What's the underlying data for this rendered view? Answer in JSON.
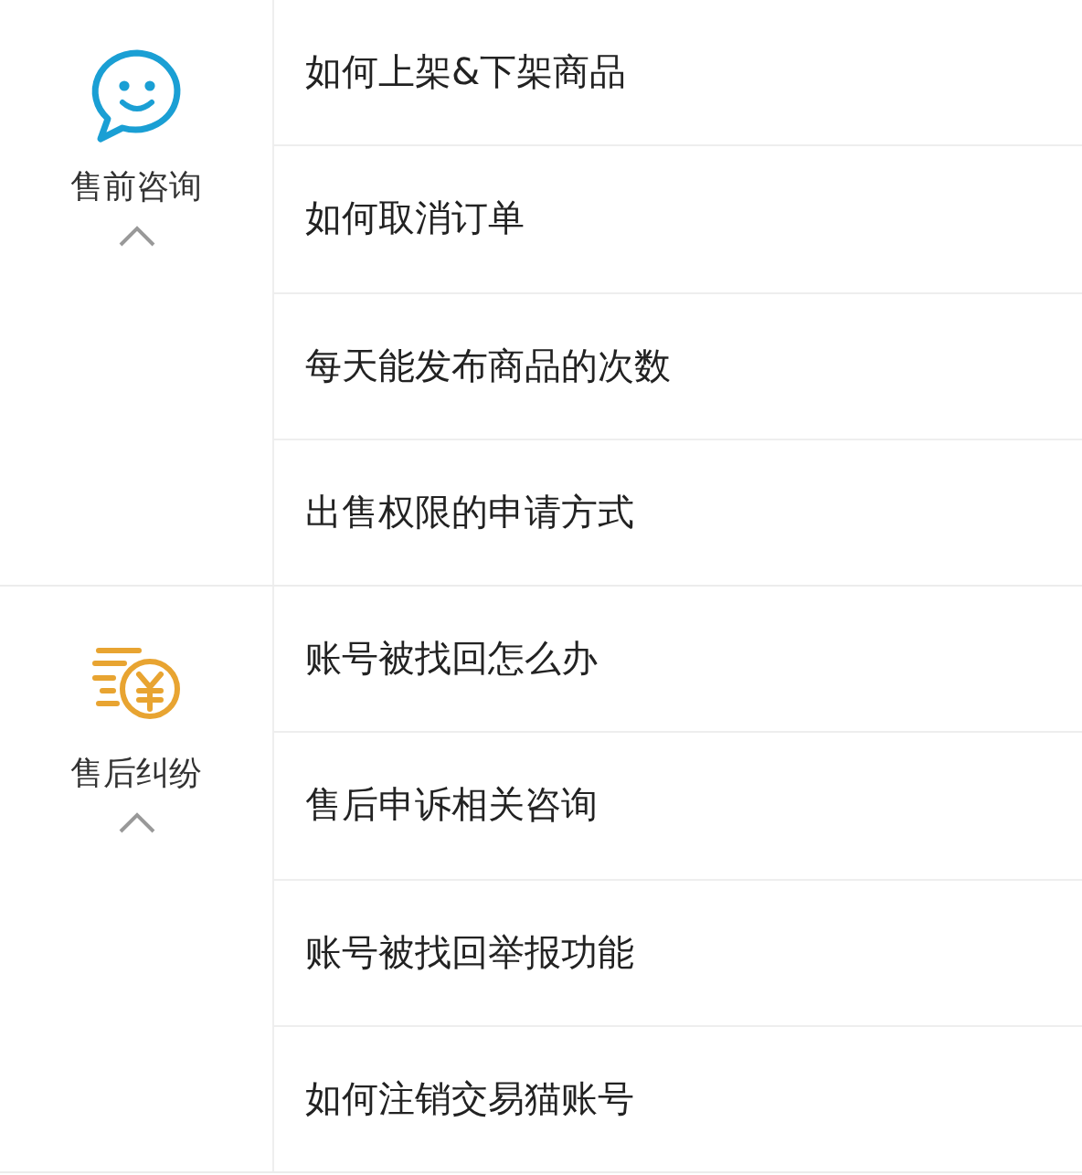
{
  "categories": [
    {
      "kind": "chat",
      "label": "售前咨询",
      "expanded": true,
      "questions": [
        "如何上架&下架商品",
        "如何取消订单",
        "每天能发布商品的次数",
        "出售权限的申请方式"
      ]
    },
    {
      "kind": "coin",
      "label": "售后纠纷",
      "expanded": true,
      "questions": [
        "账号被找回怎么办",
        "售后申诉相关咨询",
        "账号被找回举报功能",
        "如何注销交易猫账号"
      ]
    }
  ]
}
